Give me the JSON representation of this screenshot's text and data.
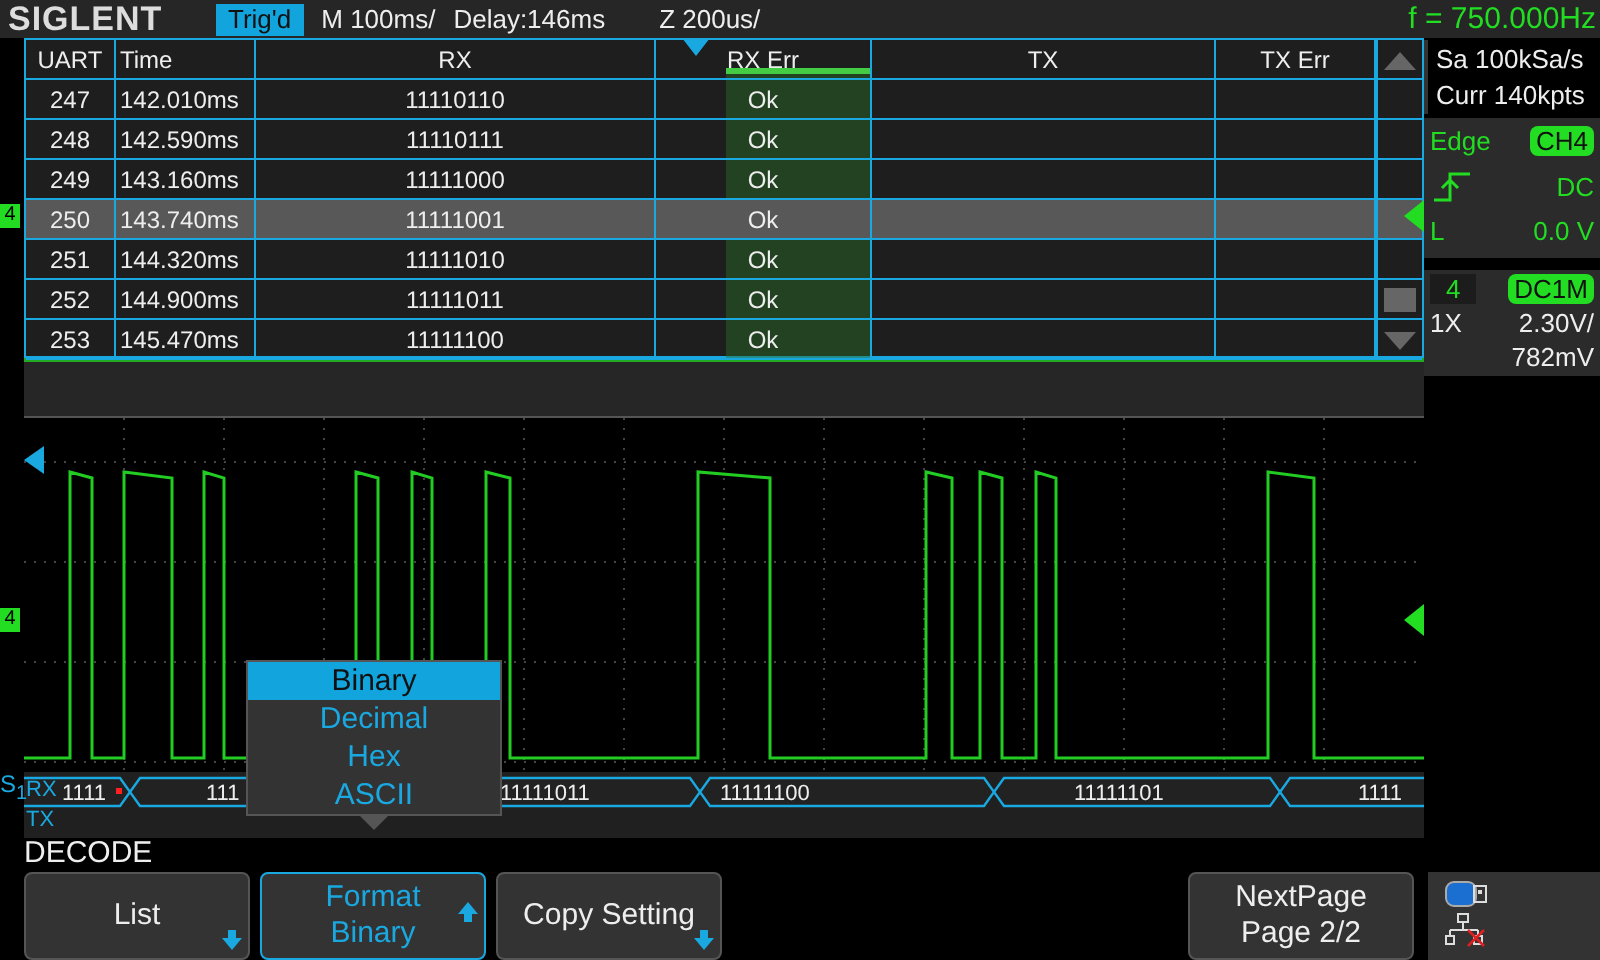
{
  "top_bar": {
    "logo": "SIGLENT",
    "trigger_status": "Trig'd",
    "timebase": "M 100ms/",
    "delay": "Delay:146ms",
    "zoom": "Z 200us/",
    "frequency": "f = 750.000Hz"
  },
  "table": {
    "columns": [
      "UART",
      "Time",
      "RX",
      "RX Err",
      "TX",
      "TX Err"
    ],
    "rows": [
      {
        "index": "247",
        "time": "142.010ms",
        "rx": "11110110",
        "rx_err": "Ok",
        "selected": false
      },
      {
        "index": "248",
        "time": "142.590ms",
        "rx": "11110111",
        "rx_err": "Ok",
        "selected": false
      },
      {
        "index": "249",
        "time": "143.160ms",
        "rx": "11111000",
        "rx_err": "Ok",
        "selected": false
      },
      {
        "index": "250",
        "time": "143.740ms",
        "rx": "11111001",
        "rx_err": "Ok",
        "selected": true
      },
      {
        "index": "251",
        "time": "144.320ms",
        "rx": "11111010",
        "rx_err": "Ok",
        "selected": false
      },
      {
        "index": "252",
        "time": "144.900ms",
        "rx": "11111011",
        "rx_err": "Ok",
        "selected": false
      },
      {
        "index": "253",
        "time": "145.470ms",
        "rx": "11111100",
        "rx_err": "Ok",
        "selected": false
      }
    ]
  },
  "channel_markers": [
    "4",
    "4"
  ],
  "acquisition": {
    "sample_rate": "Sa 100kSa/s",
    "memory": "Curr 140kpts"
  },
  "trigger": {
    "type": "Edge",
    "source": "CH4",
    "coupling": "DC",
    "level_label": "L",
    "level_value": "0.0 V"
  },
  "channel": {
    "number": "4",
    "coupling": "DC1M",
    "probe": "1X",
    "scale": "2.30V/",
    "offset": "782mV"
  },
  "bus": {
    "label": "S$_{1}$",
    "lines": [
      "RX",
      "TX"
    ],
    "segments": [
      {
        "value": "1111",
        "error": true
      },
      {
        "value": "111",
        "error": false
      },
      {
        "value": "11111011",
        "error": false
      },
      {
        "value": "11111100",
        "error": false
      },
      {
        "value": "11111101",
        "error": false
      },
      {
        "value": "1111",
        "error": false
      }
    ]
  },
  "format_menu": {
    "items": [
      {
        "label": "Binary",
        "selected": true
      },
      {
        "label": "Decimal",
        "selected": false
      },
      {
        "label": "Hex",
        "selected": false
      },
      {
        "label": "ASCII",
        "selected": false
      }
    ]
  },
  "menu_title": "DECODE",
  "softkeys": [
    {
      "label": "List",
      "kind": "down-arrow",
      "active": false
    },
    {
      "label": "Format",
      "value": "Binary",
      "kind": "up-arrow",
      "active": true
    },
    {
      "label": "Copy Setting",
      "kind": "down-arrow",
      "active": false
    },
    {
      "label": "NextPage",
      "value": "Page 2/2",
      "active": false
    }
  ]
}
